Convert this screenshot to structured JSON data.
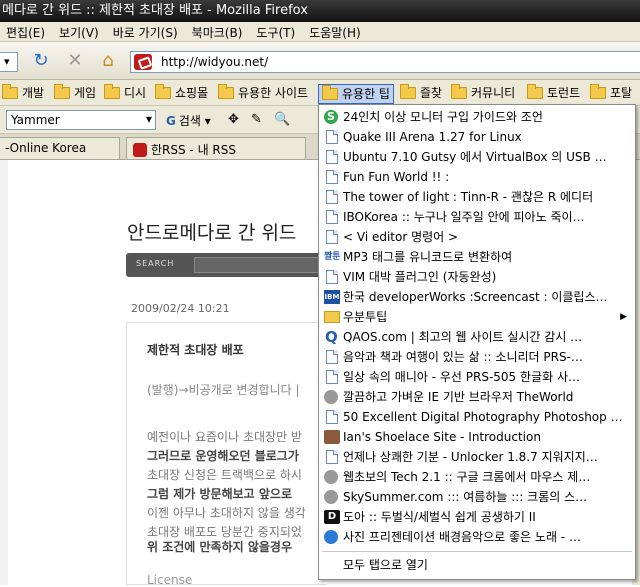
{
  "window": {
    "title": "메다로 간 위드 :: 제한적 초대장 배포 - Mozilla Firefox"
  },
  "menu": [
    "편집(E)",
    "보기(V)",
    "바로 가기(S)",
    "북마크(B)",
    "도구(T)",
    "도움말(H)"
  ],
  "nav": {
    "url": "http://widyou.net/"
  },
  "bookmarks": [
    {
      "label": "개발"
    },
    {
      "label": "게임"
    },
    {
      "label": "디시"
    },
    {
      "label": "쇼핑몰"
    },
    {
      "label": "유용한 사이트"
    },
    {
      "label": "유용한 팁"
    },
    {
      "label": "즐찾"
    },
    {
      "label": "커뮤니티"
    },
    {
      "label": "토런트"
    },
    {
      "label": "포탈"
    }
  ],
  "toolbar": {
    "yammer": "Yammer",
    "search_label": "검색",
    "g": "G"
  },
  "tabs": [
    {
      "label": "-Online Korea"
    },
    {
      "label": "한RSS - 내 RSS"
    }
  ],
  "page": {
    "blog_title": "안드로메다로 간 위드",
    "search_label": "SEARCH",
    "date": "2009/02/24 10:21",
    "post_title": "제한적 초대장 배포",
    "p1": "(발행)→비공개로 변경합니다 |",
    "lines": [
      "예전이나 요즘이나 초대장만 받",
      "그러므로 운영해오던 블로그가",
      "초대장 신청은 트랙백으로 하시",
      "그럼 제가 방문해보고 앞으로",
      "이젠 아무나 초대하지 않을 생각",
      "초대장 배포도 당분간 중지되었"
    ],
    "condition": "위 조건에 만족하지 않을경우",
    "license": "License"
  },
  "dropdown": {
    "items": [
      {
        "label": "24인치 이상 모니터 구입 가이드와 조언",
        "icon": "green-s-icon"
      },
      {
        "label": "Quake III Arena 1.27 for Linux",
        "icon": "page-icon"
      },
      {
        "label": "Ubuntu 7.10 Gutsy 에서 VirtualBox 의 USB …",
        "icon": "page-icon"
      },
      {
        "label": "Fun Fun World !! :",
        "icon": "page-icon"
      },
      {
        "label": "The tower of light : Tinn-R - 괜찮은 R 에디터",
        "icon": "page-icon"
      },
      {
        "label": "IBOKorea :: 누구나 일주일 안에 피아노 죽이…",
        "icon": "page-icon"
      },
      {
        "label": "< Vi editor 명령어 >",
        "icon": "page-icon"
      },
      {
        "label": "MP3 태그를 유니코드로 변환하여",
        "icon": "korean-icon"
      },
      {
        "label": "VIM 대박 플러그인 (자동완성)",
        "icon": "page-icon"
      },
      {
        "label": "한국 developerWorks :Screencast : 이클립스…",
        "icon": "ibm-icon"
      },
      {
        "label": "우분투팁",
        "icon": "folder-icon",
        "submenu": true
      },
      {
        "label": "QAOS.com | 최고의 웹 사이트 실시간 감시 …",
        "icon": "q-icon"
      },
      {
        "label": "음악과 책과 여행이 있는 삶 :: 소니리더 PRS-…",
        "icon": "page-icon"
      },
      {
        "label": "일상 속의 매니아 - 우선 PRS-505 한글화 사…",
        "icon": "page-icon"
      },
      {
        "label": "깔끔하고 가벼운 IE 기반 브라우저 TheWorld",
        "icon": "gear-icon"
      },
      {
        "label": "50 Excellent Digital Photography Photoshop …",
        "icon": "page-icon"
      },
      {
        "label": "Ian's Shoelace Site - Introduction",
        "icon": "avatar-icon"
      },
      {
        "label": "언제나 상쾌한 기분 - Unlocker 1.8.7 지워지지…",
        "icon": "page-icon"
      },
      {
        "label": "웹초보의 Tech 2.1 :: 구글 크롬에서 마우스 제…",
        "icon": "gear-icon"
      },
      {
        "label": "SkySummer.com ::: 여름하늘 ::: 크롬의 스…",
        "icon": "gear-icon"
      },
      {
        "label": "도아 :: 두벌식/세벌식 쉽게 공생하기 II",
        "icon": "d-icon"
      },
      {
        "label": "사진 프리젠테이션 배경음악으로 좋은 노래 - …",
        "icon": "globe-icon"
      }
    ],
    "open_all": "모두 탭으로 열기"
  }
}
